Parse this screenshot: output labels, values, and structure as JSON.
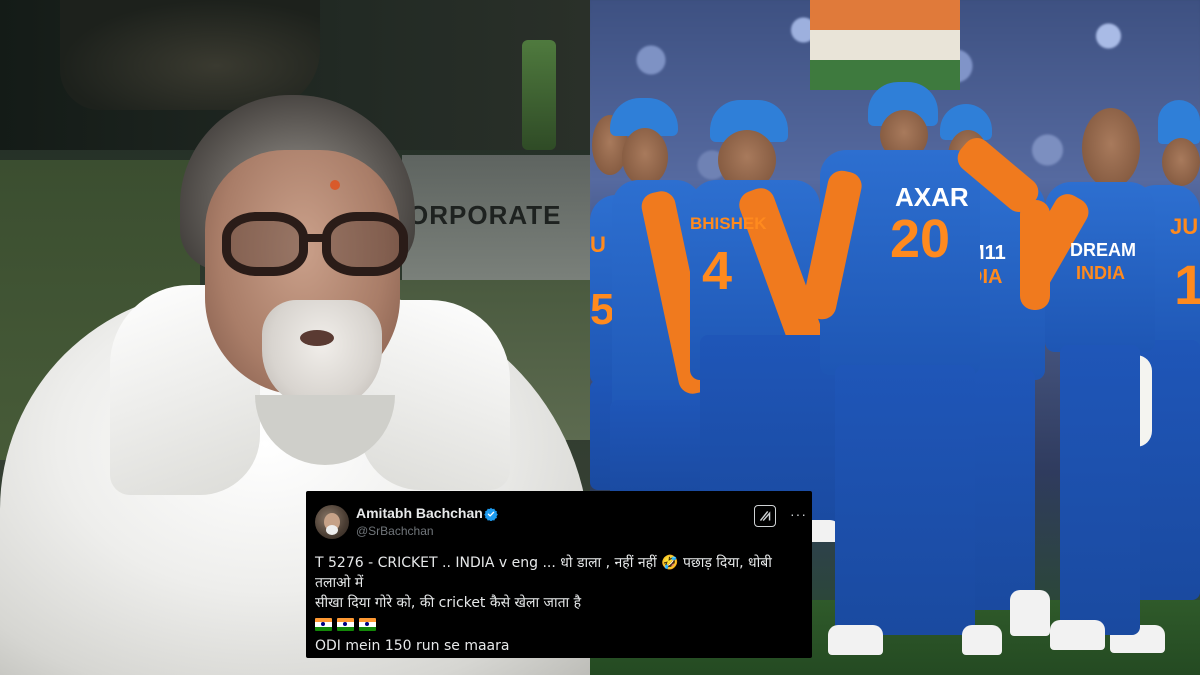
{
  "left_photo": {
    "sign_text": "ORPORATE"
  },
  "right_photo": {
    "jerseys": {
      "axar_name": "AXAR",
      "axar_number": "20",
      "abhishek_name": "BHISHEK",
      "abhishek_number": "4",
      "dream_line1": "DREAM",
      "dream_line2": "INDIA",
      "middle_line1": "M11",
      "middle_line2": "DIA",
      "right_name": "JU",
      "right_number": "1",
      "left_name": "U",
      "left_number": "5"
    }
  },
  "tweet": {
    "display_name": "Amitabh Bachchan",
    "handle": "@SrBachchan",
    "verified": true,
    "lines": [
      "T 5276 -  CRICKET ..  INDIA v eng ... धो डाला  , नहीं नहीं 🤣 पछाड़ दिया, धोबी",
      "तलाओ में",
      "सीखा दिया गोरे को, की cricket कैसे खेला जाता है"
    ],
    "flag_count": 3,
    "last_line": "ODI mein 150 run se maara",
    "icons": {
      "grok": "grok-icon",
      "more": "more-icon",
      "verified": "verified-badge-icon"
    },
    "colors": {
      "background": "#000000",
      "text": "#e7e9ea",
      "handle": "#71767b",
      "verified": "#1d9bf0"
    }
  }
}
